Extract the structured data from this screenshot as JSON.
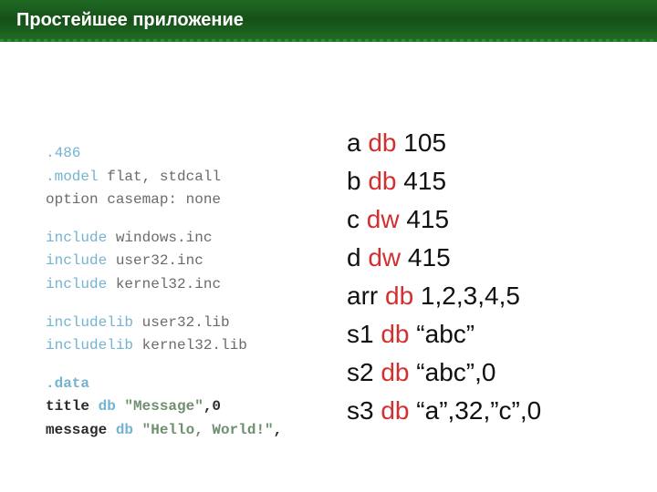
{
  "title": "Простейшее приложение",
  "code": {
    "l1": ".486",
    "l2a": ".model",
    "l2b": " flat, stdcall",
    "l3": "option casemap: none",
    "inc_kw": "include",
    "inc1": " windows.inc",
    "inc2": " user32.inc",
    "inc3": " kernel32.inc",
    "lib_kw": "includelib",
    "lib1": " user32.lib",
    "lib2": " kernel32.lib",
    "data_kw": ".data",
    "t_var": "title   ",
    "t_db": "db",
    "t_str": " \"Message\"",
    "t_end": ",0",
    "m_var": "message ",
    "m_db": "db",
    "m_str": " \"Hello, World!\"",
    "m_end": ","
  },
  "right": {
    "r1a": "a ",
    "r1b": "db",
    "r1c": " 105",
    "r2a": "b ",
    "r2b": "db",
    "r2c": " 415",
    "r3a": "c ",
    "r3b": "dw",
    "r3c": " 415",
    "r4a": "d ",
    "r4b": "dw",
    "r4c": " 415",
    "r5a": "arr ",
    "r5b": "db",
    "r5c": " 1,2,3,4,5",
    "r6a": "s1 ",
    "r6b": "db",
    "r6c": " “abc”",
    "r7a": "s2 ",
    "r7b": "db",
    "r7c": " “abc”,0",
    "r8a": "s3 ",
    "r8b": "db",
    "r8c": " “a”,32,”c”,0"
  }
}
